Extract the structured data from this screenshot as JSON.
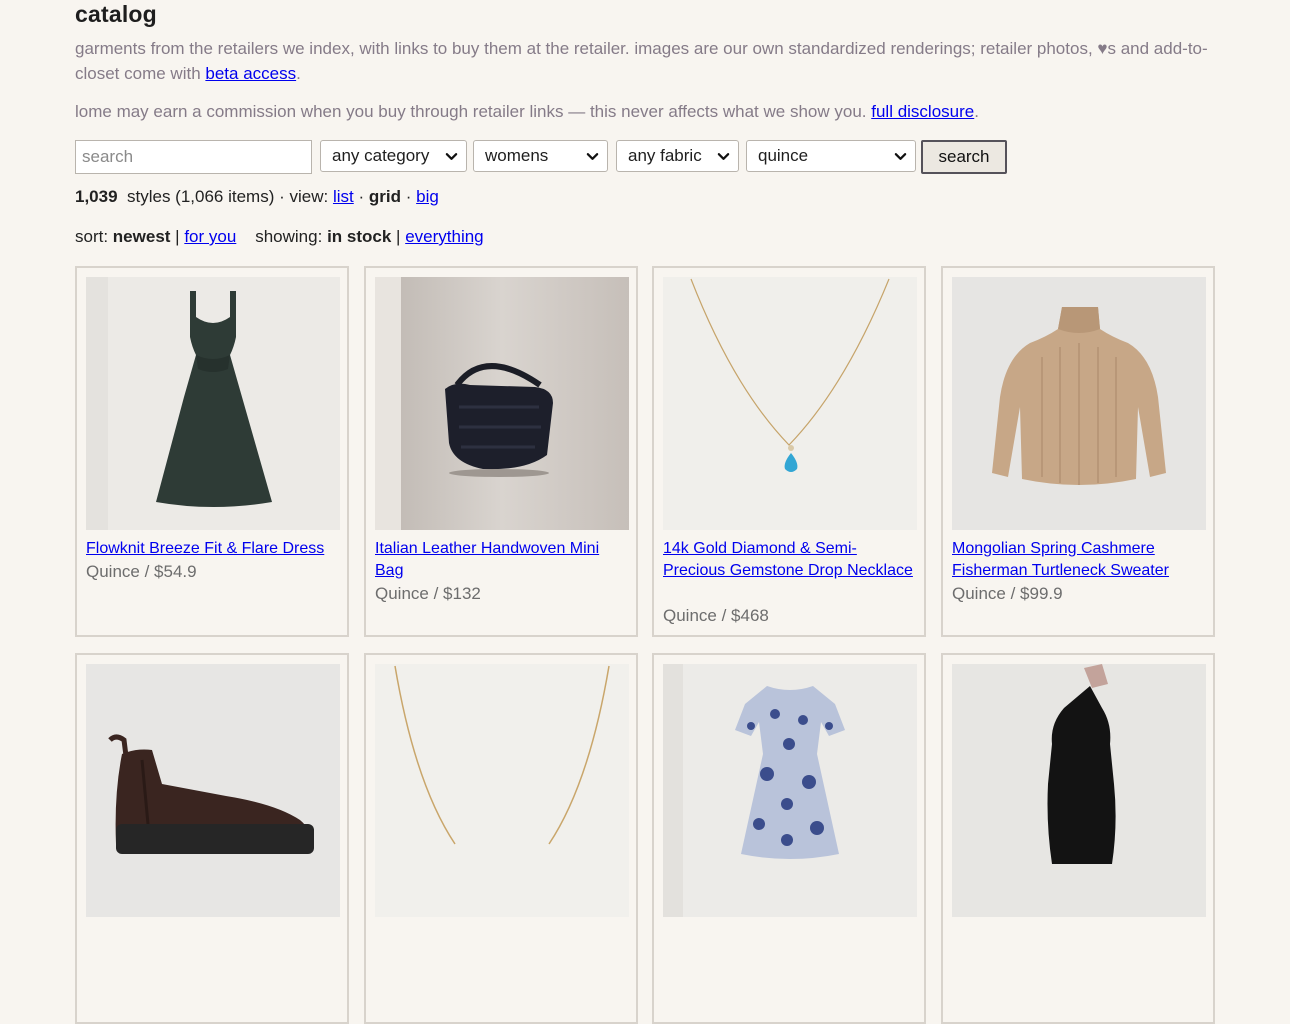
{
  "header": {
    "title": "catalog",
    "intro_text": "garments from the retailers we index, with links to buy them at the retailer. images are our own standardized renderings; retailer photos, ♥s and add-to-closet come with ",
    "beta_link": "beta access",
    "period": ".",
    "disclosure_text": "lome may earn a commission when you buy through retailer links — this never affects what we show you. ",
    "disclosure_link": "full disclosure"
  },
  "filters": {
    "search_placeholder": "search",
    "category": "any category",
    "gender": "womens",
    "fabric": "any fabric",
    "retailer": "quince",
    "search_button": "search"
  },
  "stats": {
    "styles_count": "1,039",
    "styles_text": "styles (1,066 items) · view:",
    "view_list": "list",
    "sep": "·",
    "view_grid": "grid",
    "view_big": "big"
  },
  "sort": {
    "label": "sort:",
    "newest": "newest",
    "pipe": "|",
    "for_you": "for you",
    "showing_label": "showing:",
    "in_stock": "in stock",
    "everything": "everything"
  },
  "products": [
    {
      "title": "Flowknit Breeze Fit & Flare Dress",
      "meta": "Quince / $54.9",
      "icon": "dress-icon"
    },
    {
      "title": "Italian Leather Handwoven Mini Bag",
      "meta": "Quince / $132",
      "icon": "bag-icon"
    },
    {
      "title": "14k Gold Diamond & Semi-Precious Gemstone Drop Necklace",
      "meta": "Quince / $468",
      "icon": "necklace-icon"
    },
    {
      "title": "Mongolian Spring Cashmere Fisherman Turtleneck Sweater",
      "meta": "Quince / $99.9",
      "icon": "sweater-icon"
    },
    {
      "title": "",
      "meta": "",
      "icon": "boot-icon"
    },
    {
      "title": "",
      "meta": "",
      "icon": "chain-icon"
    },
    {
      "title": "",
      "meta": "",
      "icon": "floral-dress-icon"
    },
    {
      "title": "",
      "meta": "",
      "icon": "halter-dress-icon"
    }
  ],
  "colors": {
    "background": "#f8f5f0",
    "link": "#0000ee",
    "muted_text": "#857b88",
    "card_border": "#d8d3cc"
  }
}
